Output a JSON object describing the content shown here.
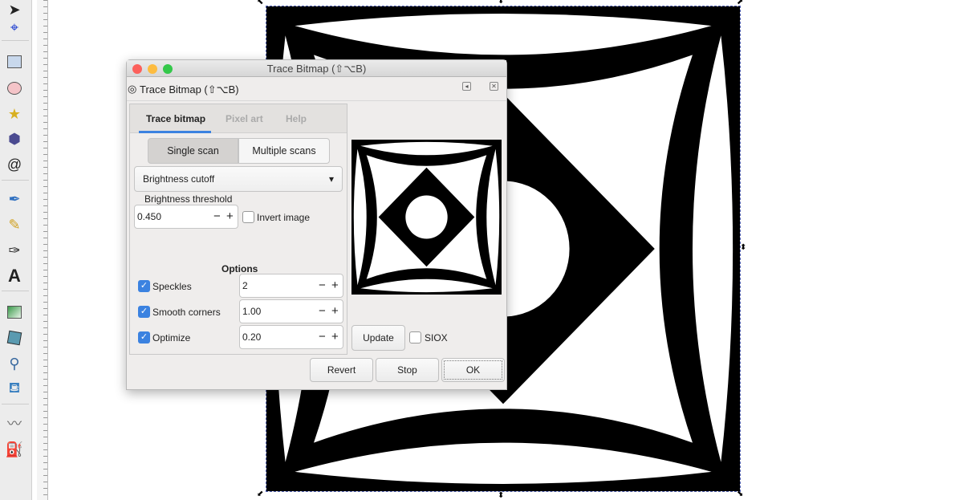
{
  "window": {
    "title": "Trace Bitmap (⇧⌥B)"
  },
  "dock": {
    "title": "Trace Bitmap (⇧⌥B)"
  },
  "tabs": [
    {
      "label": "Trace bitmap",
      "active": true
    },
    {
      "label": "Pixel art"
    },
    {
      "label": "Help"
    }
  ],
  "scan_modes": {
    "single": "Single scan",
    "multiple": "Multiple scans",
    "selected": "Single scan"
  },
  "mode_select": {
    "value": "Brightness cutoff"
  },
  "threshold": {
    "label": "Brightness threshold",
    "value": "0.450"
  },
  "invert": {
    "label": "Invert image",
    "checked": false
  },
  "options": {
    "heading": "Options",
    "speckles": {
      "label": "Speckles",
      "checked": true,
      "value": "2"
    },
    "smooth": {
      "label": "Smooth corners",
      "checked": true,
      "value": "1.00"
    },
    "optimize": {
      "label": "Optimize",
      "checked": true,
      "value": "0.20"
    }
  },
  "update_label": "Update",
  "siox": {
    "label": "SIOX",
    "checked": false
  },
  "buttons": {
    "revert": "Revert",
    "stop": "Stop",
    "ok": "OK"
  },
  "colors": {
    "accent": "#3b82e0",
    "close": "#fc605b",
    "minimize": "#fdbc40",
    "zoom": "#34c84a"
  },
  "icons": [
    "selector",
    "node",
    "rectangle",
    "ellipse",
    "star",
    "3d-box",
    "spiral",
    "pen",
    "pencil",
    "calligraphy",
    "text",
    "gradient",
    "mesh",
    "dropper",
    "paint-bucket",
    "tweak",
    "spray"
  ],
  "glyphs": {
    "minus": "−",
    "plus": "+",
    "check": "✓",
    "dropdown": "▾",
    "pm_sign": "±"
  }
}
